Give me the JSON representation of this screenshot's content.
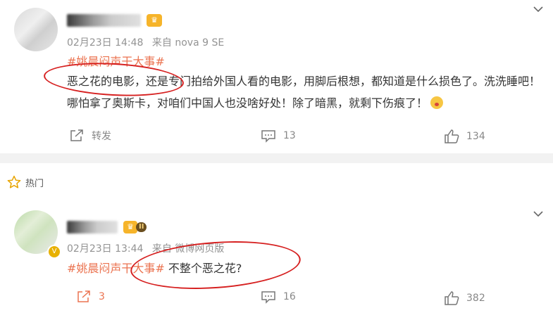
{
  "post1": {
    "date": "02月23日 14:48",
    "source": "来自 nova 9 SE",
    "hashtag": "#姚晨闷声干大事#",
    "text": "恶之花的电影，还是专门拍给外国人看的电影，用脚后根想，都知道是什么损色了。洗洗睡吧！哪怕拿了奥斯卡，对咱们中国人也没啥好处！除了暗黑，就剩下伤痕了！",
    "actions": {
      "repost": "转发",
      "comments": "13",
      "likes": "134"
    }
  },
  "section": {
    "hot_label": "热门"
  },
  "post2": {
    "date": "02月23日 13:44",
    "source": "来自 微博网页版",
    "hashtag": "#姚晨闷声干大事#",
    "text": " 不整个恶之花?",
    "level": "II",
    "actions": {
      "reposts": "3",
      "comments": "16",
      "likes": "382"
    }
  },
  "icons": {
    "share": "share-icon",
    "comment": "comment-icon",
    "like": "thumbs-up-icon",
    "chevron": "chevron-down-icon",
    "star": "star-icon"
  },
  "colors": {
    "hashtag": "#eb7350",
    "annotation": "#d62020",
    "separator": "#f2f2f2"
  }
}
